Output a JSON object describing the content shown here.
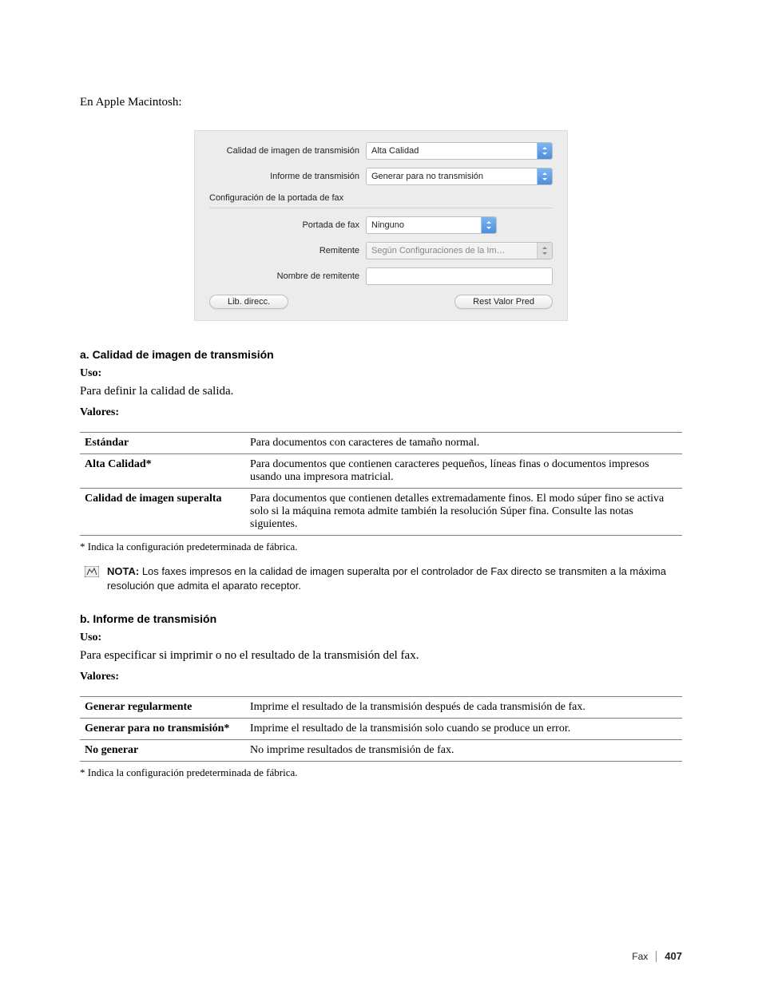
{
  "intro": "En Apple Macintosh:",
  "dialog": {
    "imgQualityLabel": "Calidad de imagen de transmisión",
    "imgQualityValue": "Alta Calidad",
    "reportLabel": "Informe de transmisión",
    "reportValue": "Generar para no transmisión",
    "coverSection": "Configuración de la portada de fax",
    "coverLabel": "Portada de fax",
    "coverValue": "Ninguno",
    "senderLabel": "Remitente",
    "senderValue": "Según Configuraciones de la Im…",
    "senderNameLabel": "Nombre de remitente",
    "btnAddress": "Lib. direcc.",
    "btnReset": "Rest Valor Pred"
  },
  "sectionA": {
    "heading": "a. Calidad de imagen de transmisión",
    "usoLabel": "Uso:",
    "usoText": "Para definir la calidad de salida.",
    "valoresLabel": "Valores:",
    "rows": [
      {
        "k": "Estándar",
        "v": "Para documentos con caracteres de tamaño normal."
      },
      {
        "k": "Alta Calidad*",
        "v": "Para documentos que contienen caracteres pequeños, líneas finas o documentos impresos usando una impresora matricial."
      },
      {
        "k": "Calidad de imagen superalta",
        "v": "Para documentos que contienen detalles extremadamente finos. El modo súper fino se activa solo si la máquina remota admite también la resolución Súper fina. Consulte las notas siguientes."
      }
    ],
    "footnote": "* Indica la configuración predeterminada de fábrica."
  },
  "note": {
    "label": "NOTA:",
    "text": "Los faxes impresos en la calidad de imagen superalta por el controlador de Fax directo se transmiten a la máxima resolución que admita el aparato receptor."
  },
  "sectionB": {
    "heading": "b. Informe de transmisión",
    "usoLabel": "Uso:",
    "usoText": "Para especificar si imprimir o no el resultado de la transmisión del fax.",
    "valoresLabel": "Valores:",
    "rows": [
      {
        "k": "Generar regularmente",
        "v": "Imprime el resultado de la transmisión después de cada transmisión de fax."
      },
      {
        "k": "Generar para no transmisión*",
        "v": "Imprime el resultado de la transmisión solo cuando se produce un error."
      },
      {
        "k": "No generar",
        "v": "No imprime resultados de transmisión de fax."
      }
    ],
    "footnote": "* Indica la configuración predeterminada de fábrica."
  },
  "footer": {
    "section": "Fax",
    "page": "407"
  }
}
